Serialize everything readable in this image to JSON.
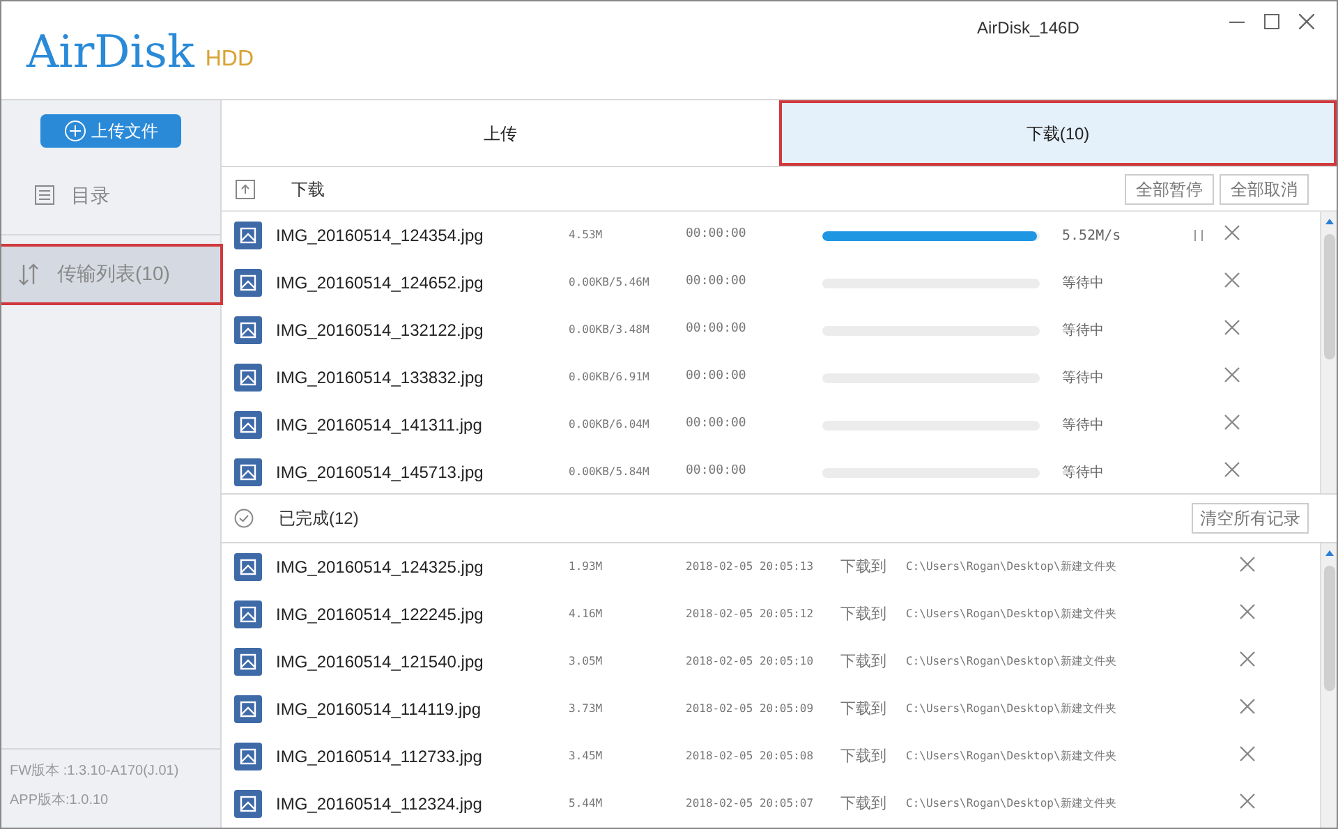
{
  "window": {
    "device": "AirDisk_146D",
    "logo": "AirDisk",
    "logo_suffix": "HDD"
  },
  "sidebar": {
    "upload_button": "上传文件",
    "items": [
      {
        "label": "目录",
        "selected": false,
        "highlighted": false
      },
      {
        "label": "传输列表(10)",
        "selected": true,
        "highlighted": true
      }
    ],
    "versions": [
      "FW版本 :1.3.10-A170(J.01)",
      "APP版本:1.0.10"
    ]
  },
  "tabs": [
    {
      "label": "上传",
      "selected": false,
      "highlighted": false
    },
    {
      "label": "下载(10)",
      "selected": true,
      "highlighted": true
    }
  ],
  "active": {
    "title": "下载",
    "buttons": [
      "全部暂停",
      "全部取消"
    ],
    "rows": [
      {
        "name": "IMG_20160514_124354.jpg",
        "size": "4.53M",
        "time": "00:00:00",
        "level": 0.99,
        "status": "5.52M/s",
        "paused": false,
        "active": true
      },
      {
        "name": "IMG_20160514_124652.jpg",
        "size": "0.00KB/5.46M",
        "time": "00:00:00",
        "level": 0,
        "status": "等待中",
        "active": false
      },
      {
        "name": "IMG_20160514_132122.jpg",
        "size": "0.00KB/3.48M",
        "time": "00:00:00",
        "level": 0,
        "status": "等待中",
        "active": false
      },
      {
        "name": "IMG_20160514_133832.jpg",
        "size": "0.00KB/6.91M",
        "time": "00:00:00",
        "level": 0,
        "status": "等待中",
        "active": false
      },
      {
        "name": "IMG_20160514_141311.jpg",
        "size": "0.00KB/6.04M",
        "time": "00:00:00",
        "level": 0,
        "status": "等待中",
        "active": false
      },
      {
        "name": "IMG_20160514_145713.jpg",
        "size": "0.00KB/5.84M",
        "time": "00:00:00",
        "level": 0,
        "status": "等待中",
        "active": false
      }
    ]
  },
  "completed": {
    "title": "已完成(12)",
    "button": "清空所有记录",
    "rows": [
      {
        "name": "IMG_20160514_124325.jpg",
        "size": "1.93M",
        "date": "2018-02-05 20:05:13",
        "label": "下载到",
        "path": "C:\\Users\\Rogan\\Desktop\\新建文件夹"
      },
      {
        "name": "IMG_20160514_122245.jpg",
        "size": "4.16M",
        "date": "2018-02-05 20:05:12",
        "label": "下载到",
        "path": "C:\\Users\\Rogan\\Desktop\\新建文件夹"
      },
      {
        "name": "IMG_20160514_121540.jpg",
        "size": "3.05M",
        "date": "2018-02-05 20:05:10",
        "label": "下载到",
        "path": "C:\\Users\\Rogan\\Desktop\\新建文件夹"
      },
      {
        "name": "IMG_20160514_114119.jpg",
        "size": "3.73M",
        "date": "2018-02-05 20:05:09",
        "label": "下载到",
        "path": "C:\\Users\\Rogan\\Desktop\\新建文件夹"
      },
      {
        "name": "IMG_20160514_112733.jpg",
        "size": "3.45M",
        "date": "2018-02-05 20:05:08",
        "label": "下载到",
        "path": "C:\\Users\\Rogan\\Desktop\\新建文件夹"
      },
      {
        "name": "IMG_20160514_112324.jpg",
        "size": "5.44M",
        "date": "2018-02-05 20:05:07",
        "label": "下载到",
        "path": "C:\\Users\\Rogan\\Desktop\\新建文件夹"
      }
    ]
  }
}
